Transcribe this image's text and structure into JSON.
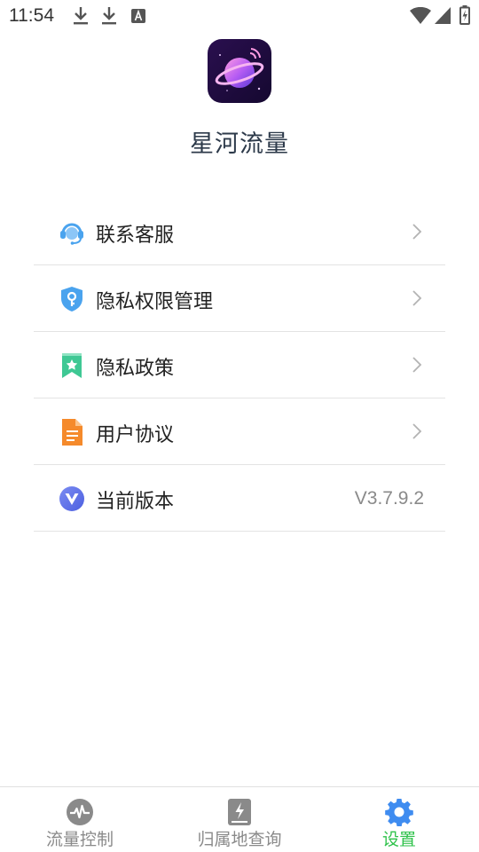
{
  "status_bar": {
    "time": "11:54",
    "left_icons": [
      "download-icon",
      "download-icon",
      "text-a-icon"
    ],
    "right_icons": [
      "wifi-icon",
      "signal-icon",
      "battery-charging-icon"
    ]
  },
  "header": {
    "app_name": "星河流量",
    "logo_icon": "planet-logo-icon"
  },
  "menu": {
    "items": [
      {
        "label": "联系客服",
        "icon": "customer-service-icon",
        "trailing": "chevron"
      },
      {
        "label": "隐私权限管理",
        "icon": "shield-key-icon",
        "trailing": "chevron"
      },
      {
        "label": "隐私政策",
        "icon": "bookmark-star-icon",
        "trailing": "chevron"
      },
      {
        "label": "用户协议",
        "icon": "document-icon",
        "trailing": "chevron"
      },
      {
        "label": "当前版本",
        "icon": "version-v-icon",
        "value": "V3.7.9.2"
      }
    ]
  },
  "bottom_nav": {
    "items": [
      {
        "label": "流量控制",
        "icon": "pulse-icon",
        "active": false
      },
      {
        "label": "归属地查询",
        "icon": "lightning-book-icon",
        "active": false
      },
      {
        "label": "设置",
        "icon": "gear-icon",
        "active": true
      }
    ],
    "active_color": "#2ec24a",
    "inactive_color": "#8a8a8a"
  }
}
